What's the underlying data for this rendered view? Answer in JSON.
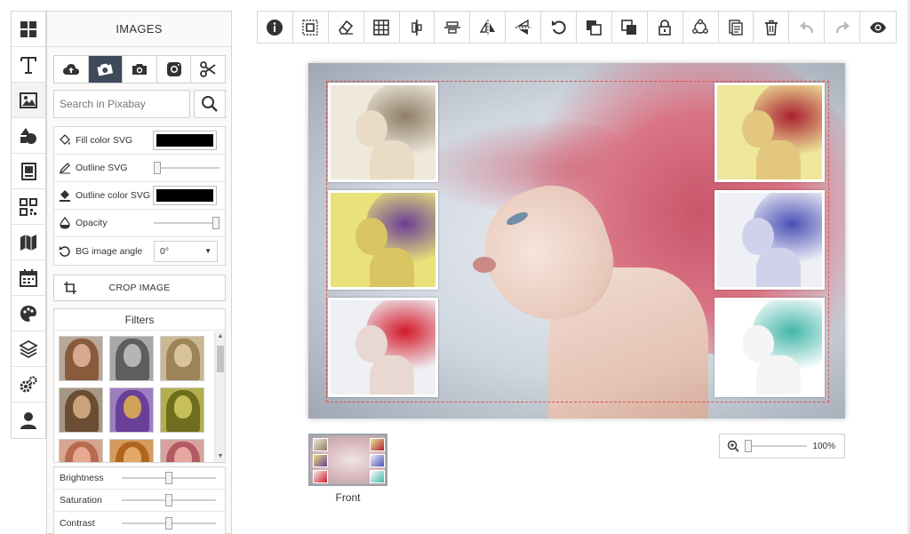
{
  "rail": [
    {
      "icon": "grid-icon",
      "active": false
    },
    {
      "icon": "text-icon",
      "active": false
    },
    {
      "icon": "image-icon",
      "active": true
    },
    {
      "icon": "shapes-icon",
      "active": false
    },
    {
      "icon": "photo-book-icon",
      "active": false
    },
    {
      "icon": "qr-code-icon",
      "active": false
    },
    {
      "icon": "map-icon",
      "active": false
    },
    {
      "icon": "calendar-icon",
      "active": false
    },
    {
      "icon": "palette-icon",
      "active": false
    },
    {
      "icon": "layers-icon",
      "active": false
    },
    {
      "icon": "settings-icon",
      "active": false
    },
    {
      "icon": "user-icon",
      "active": false
    }
  ],
  "panel": {
    "title": "IMAGES",
    "tabs": [
      {
        "icon": "upload-cloud-icon",
        "active": false
      },
      {
        "icon": "pixabay-camera-icon",
        "active": true
      },
      {
        "icon": "camera-icon",
        "active": false
      },
      {
        "icon": "instagram-icon",
        "active": false
      },
      {
        "icon": "scissors-icon",
        "active": false
      }
    ],
    "search": {
      "placeholder": "Search in Pixabay",
      "value": ""
    },
    "props": {
      "fill_color": {
        "label": "Fill color SVG",
        "color": "#000000"
      },
      "outline": {
        "label": "Outline SVG",
        "value": 0
      },
      "outline_color": {
        "label": "Outline color SVG",
        "color": "#000000"
      },
      "opacity": {
        "label": "Opacity",
        "value": 1
      },
      "bg_angle": {
        "label": "BG image angle",
        "value": "0°",
        "arrow": "▼"
      }
    },
    "crop_label": "CROP IMAGE",
    "filters_title": "Filters",
    "filters": [
      {
        "tone": "original",
        "skin": "#d9a98f",
        "hair": "#8a5a3c",
        "bg": "#b8a89a"
      },
      {
        "tone": "grayscale",
        "skin": "#b5b5b5",
        "hair": "#5e5e5e",
        "bg": "#a8a8a8"
      },
      {
        "tone": "sepia",
        "skin": "#d8c39a",
        "hair": "#9d8358",
        "bg": "#c9b993"
      },
      {
        "tone": "warm",
        "skin": "#c9a37a",
        "hair": "#6a4d33",
        "bg": "#a49882"
      },
      {
        "tone": "purple",
        "skin": "#d0a25a",
        "hair": "#6a3f9a",
        "bg": "#9b7fbf"
      },
      {
        "tone": "olive",
        "skin": "#c7c05a",
        "hair": "#6f6d1e",
        "bg": "#b3af4e"
      },
      {
        "tone": "peach",
        "skin": "#e4a98f",
        "hair": "#b86a4f",
        "bg": "#d7a48f"
      },
      {
        "tone": "orange",
        "skin": "#e3a767",
        "hair": "#b0651f",
        "bg": "#d49b5c"
      },
      {
        "tone": "rose",
        "skin": "#e6a7a0",
        "hair": "#b35b62",
        "bg": "#d6a49c"
      }
    ],
    "adjust": {
      "brightness": {
        "label": "Brightness",
        "value": 0.5
      },
      "saturation": {
        "label": "Saturation",
        "value": 0.5
      },
      "contrast": {
        "label": "Contrast",
        "value": 0.5
      }
    }
  },
  "toolbar": [
    "info-icon",
    "select-area-icon",
    "eraser-icon",
    "grid-table-icon",
    "align-vertical-center-icon",
    "align-horizontal-center-icon",
    "flip-horizontal-icon",
    "flip-vertical-icon",
    "rotate-icon",
    "bring-forward-icon",
    "send-backward-icon",
    "lock-icon",
    "group-icon",
    "duplicate-icon",
    "delete-icon",
    "undo-icon",
    "redo-icon",
    "preview-eye-icon"
  ],
  "canvas_photos": [
    {
      "name": "sepia",
      "bg": "#efe9dd",
      "skin": "#e8dcc6",
      "hair": "#8e7e66"
    },
    {
      "name": "yellow-purple",
      "bg": "#e9e27a",
      "skin": "#d9c561",
      "hair": "#6b3f95"
    },
    {
      "name": "red",
      "bg": "#eef0f3",
      "skin": "#e9d8d2",
      "hair": "#d3192a"
    },
    {
      "name": "red-yellow",
      "bg": "#efe79a",
      "skin": "#e3c77e",
      "hair": "#a92030"
    },
    {
      "name": "blue",
      "bg": "#eef0f6",
      "skin": "#cfd2ea",
      "hair": "#4b4fb6"
    },
    {
      "name": "teal",
      "bg": "#ffffff",
      "skin": "#f5f5f5",
      "hair": "#43b6a9"
    }
  ],
  "pages": [
    {
      "label": "Front"
    }
  ],
  "zoom": {
    "label": "100%",
    "value": 0
  }
}
